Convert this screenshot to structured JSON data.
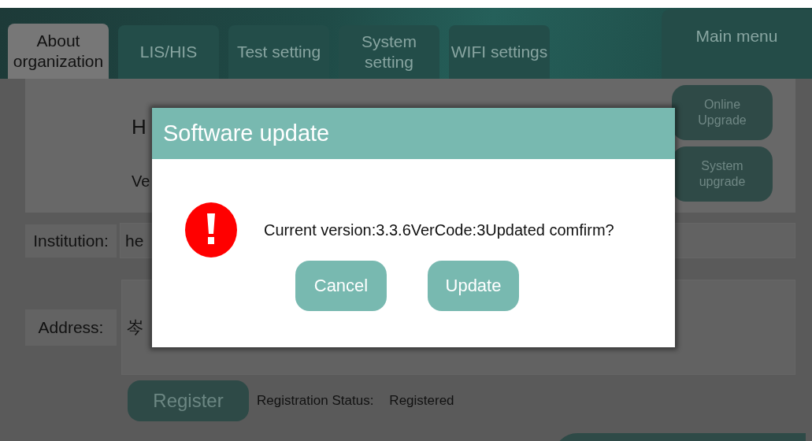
{
  "tabs": [
    {
      "label": "About organization",
      "selected": true
    },
    {
      "label": "LIS/HIS",
      "selected": false
    },
    {
      "label": "Test setting",
      "selected": false
    },
    {
      "label": "System setting",
      "selected": false
    },
    {
      "label": "WIFI settings",
      "selected": false
    }
  ],
  "main_menu": "Main menu",
  "about": {
    "name": "H",
    "version": "Ve"
  },
  "upgrade_buttons": [
    "Online Upgrade",
    "System upgrade"
  ],
  "institution": {
    "label": "Institution:",
    "value": "he"
  },
  "address": {
    "label": "Address:",
    "value": "岑"
  },
  "register": {
    "button": "Register",
    "status_label": "Registration Status:",
    "status": "Registered"
  },
  "dialog": {
    "title": "Software update",
    "message": "Current version:3.3.6VerCode:3Updated comfirm?",
    "buttons": [
      "Cancel",
      "Update"
    ]
  }
}
